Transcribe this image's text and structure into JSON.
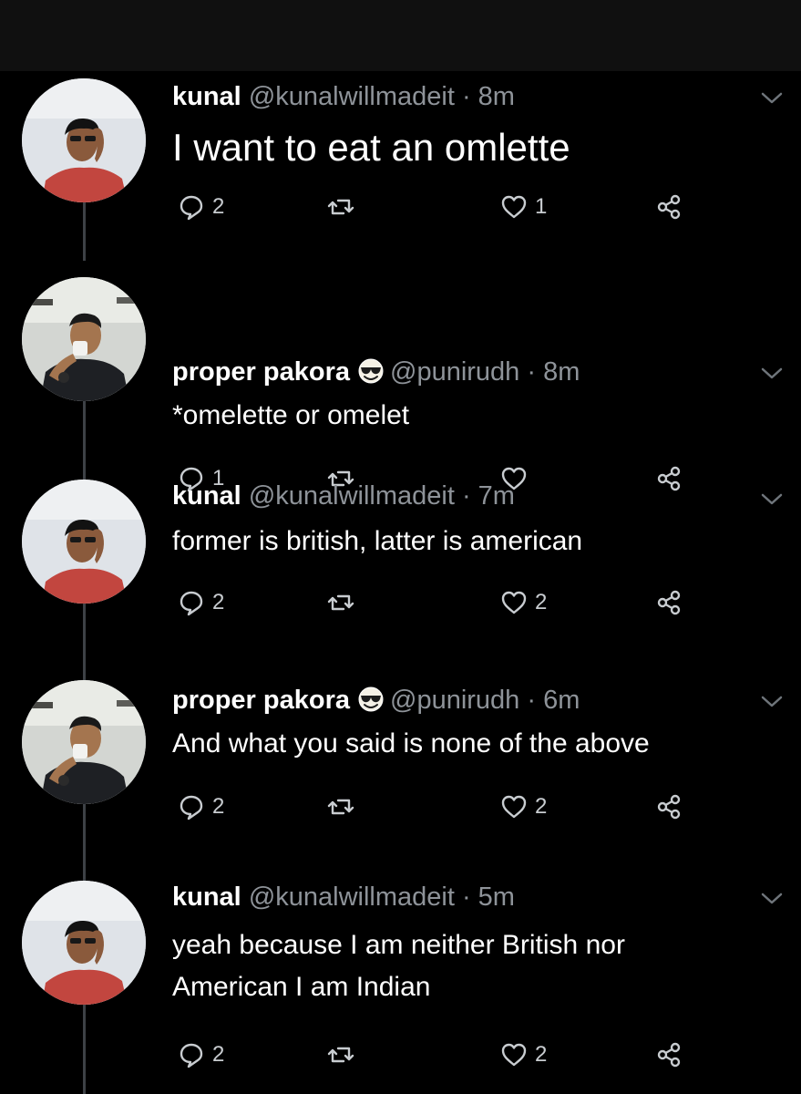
{
  "tweets": [
    {
      "name": "kunal",
      "handle": "@kunalwillmadeit",
      "time": "· 8m",
      "text": "I want to eat an omlette",
      "replies": "2",
      "retweets": "",
      "likes": "1",
      "emoji": false,
      "avatar": "kunal"
    },
    {
      "name": "proper pakora",
      "handle": "@punirudh",
      "time": "· 8m",
      "text": "*omelette or omelet",
      "replies": "1",
      "retweets": "",
      "likes": "",
      "emoji": true,
      "emoji_icon": "smiling-face-with-sunglasses-icon",
      "avatar": "pakora"
    },
    {
      "name": "kunal",
      "handle": "@kunalwillmadeit",
      "time": "· 7m",
      "text": "former is british, latter is american",
      "replies": "2",
      "retweets": "",
      "likes": "2",
      "emoji": false,
      "avatar": "kunal"
    },
    {
      "name": "proper pakora",
      "handle": "@punirudh",
      "time": "· 6m",
      "text": "And what you said is none of the above",
      "replies": "2",
      "retweets": "",
      "likes": "2",
      "emoji": true,
      "emoji_icon": "smiling-face-with-sunglasses-icon",
      "avatar": "pakora"
    },
    {
      "name": "kunal",
      "handle": "@kunalwillmadeit",
      "time": "· 5m",
      "text": "yeah because I am neither British nor American I am Indian",
      "replies": "2",
      "retweets": "",
      "likes": "2",
      "emoji": false,
      "avatar": "kunal"
    }
  ],
  "icons": {
    "reply": "reply-icon",
    "retweet": "retweet-icon",
    "like": "heart-icon",
    "share": "share-icon",
    "more": "chevron-down-icon"
  },
  "colors": {
    "background": "#000000",
    "top_bar": "#101010",
    "name": "#ffffff",
    "meta": "#8e9399",
    "icon": "#c8ccd0",
    "thread_line": "#3d4146",
    "kunal_shirt": "#c2463f",
    "pakora_shirt": "#1e2024"
  }
}
